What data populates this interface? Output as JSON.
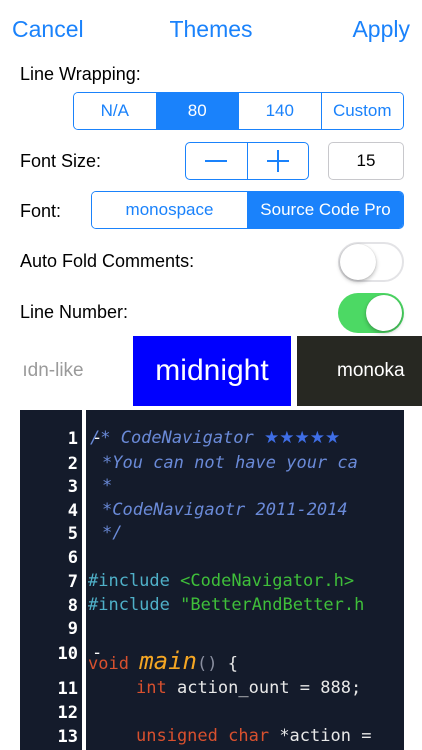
{
  "navbar": {
    "cancel": "Cancel",
    "title": "Themes",
    "apply": "Apply"
  },
  "line_wrapping": {
    "label": "Line Wrapping:",
    "options": [
      "N/A",
      "80",
      "140",
      "Custom"
    ],
    "selected": "80"
  },
  "font_size": {
    "label": "Font Size:",
    "value": "15"
  },
  "font": {
    "label": "Font:",
    "options": [
      "monospace",
      "Source Code Pro"
    ],
    "selected": "Source Code Pro"
  },
  "auto_fold": {
    "label": "Auto Fold Comments:",
    "on": false
  },
  "line_number": {
    "label": "Line Number:",
    "on": true
  },
  "themes": [
    "ıdn-like",
    "midnight",
    "monoka"
  ],
  "colors": {
    "accent": "#1a82fb",
    "switch_on": "#4cd964",
    "midnight": "#0000ff",
    "monokai": "#272822",
    "code_bg": "#141b2b"
  },
  "code": {
    "line_numbers": [
      "1",
      "2",
      "3",
      "4",
      "5",
      "6",
      "7",
      "8",
      "9",
      "10",
      "11",
      "12",
      "13"
    ],
    "l1": "/* CodeNavigator",
    "l1_stars": "★★★★★",
    "l2": "*You can not have your ca",
    "l3": "*",
    "l4": "*CodeNavigaotr 2011-2014",
    "l5": "*/",
    "l7_pre": "#include",
    "l7_inc": "<CodeNavigator.h>",
    "l8_pre": "#include",
    "l8_inc": "\"BetterAndBetter.h",
    "l10_kw": "void",
    "l10_fn": "main",
    "l10_paren": "()",
    "l10_rest": "{",
    "l11_kw": "int",
    "l11_rest": "action_ount = 888;",
    "l13_kw": "unsigned char",
    "l13_rest": "*action ="
  }
}
